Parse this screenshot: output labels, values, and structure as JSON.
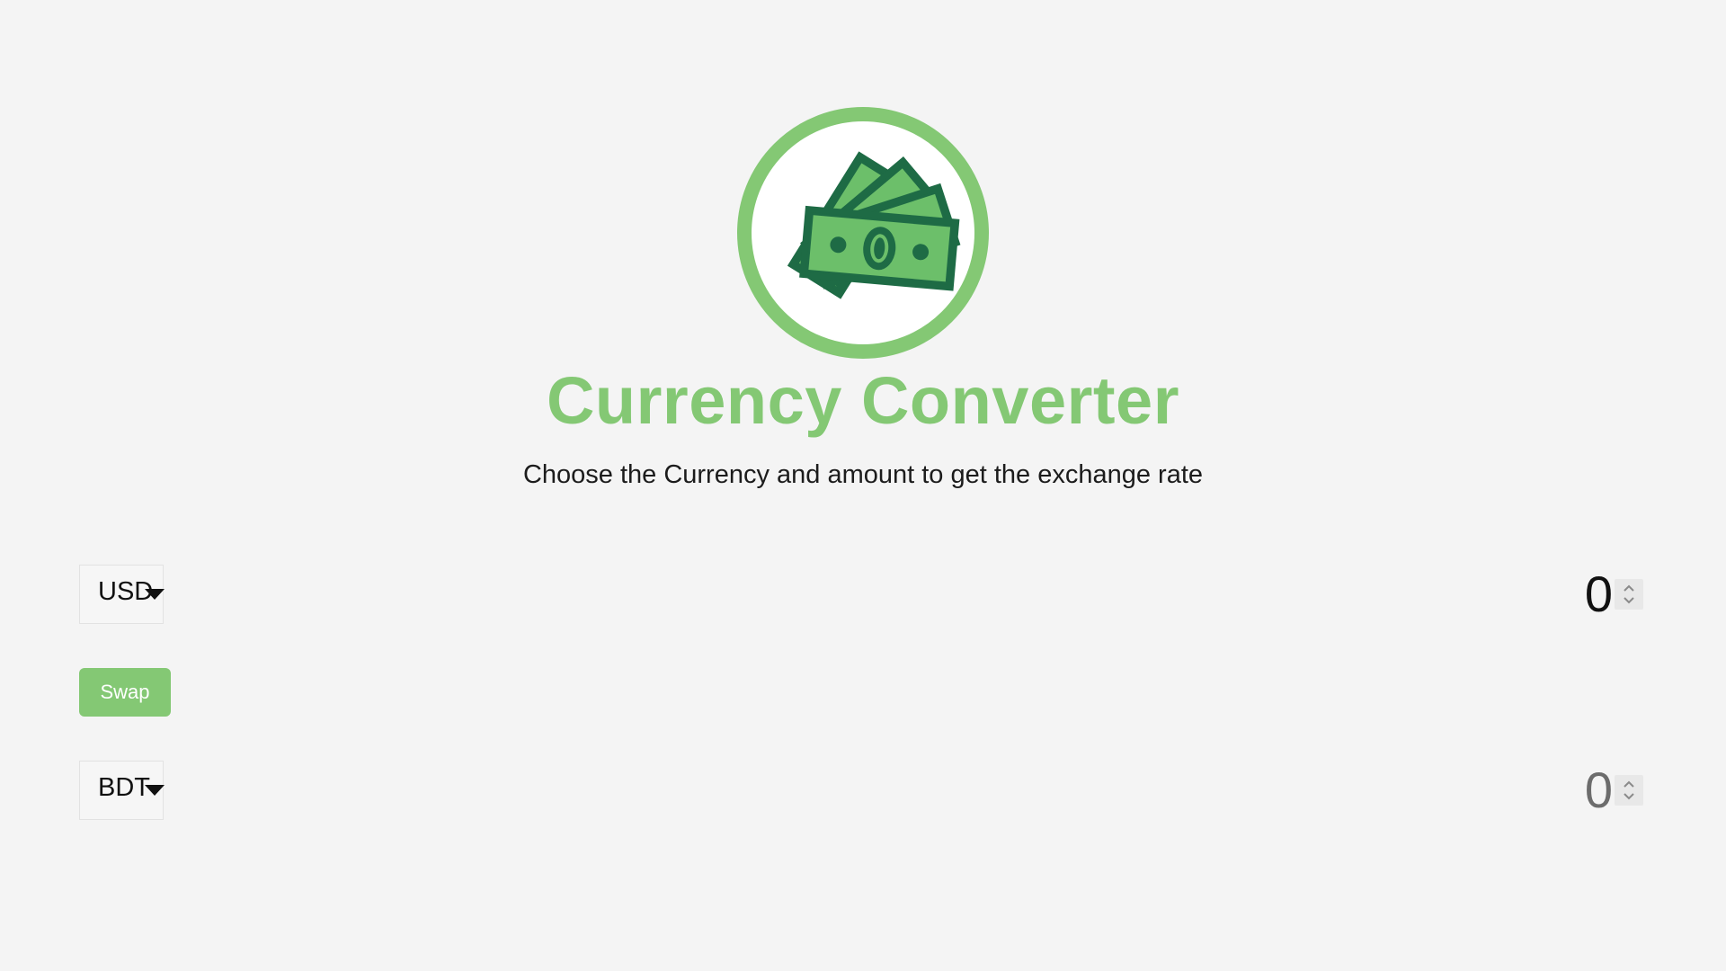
{
  "header": {
    "logo_icon": "money-bills-icon",
    "title": "Currency Converter",
    "subtitle": "Choose the Currency and amount to get the exchange rate"
  },
  "colors": {
    "accent": "#84c874",
    "accent_dark": "#1e6b45",
    "background": "#f4f4f4"
  },
  "converter": {
    "from": {
      "currency": "USD",
      "amount": "0"
    },
    "swap_label": "Swap",
    "to": {
      "currency": "BDT",
      "amount": "0"
    }
  }
}
